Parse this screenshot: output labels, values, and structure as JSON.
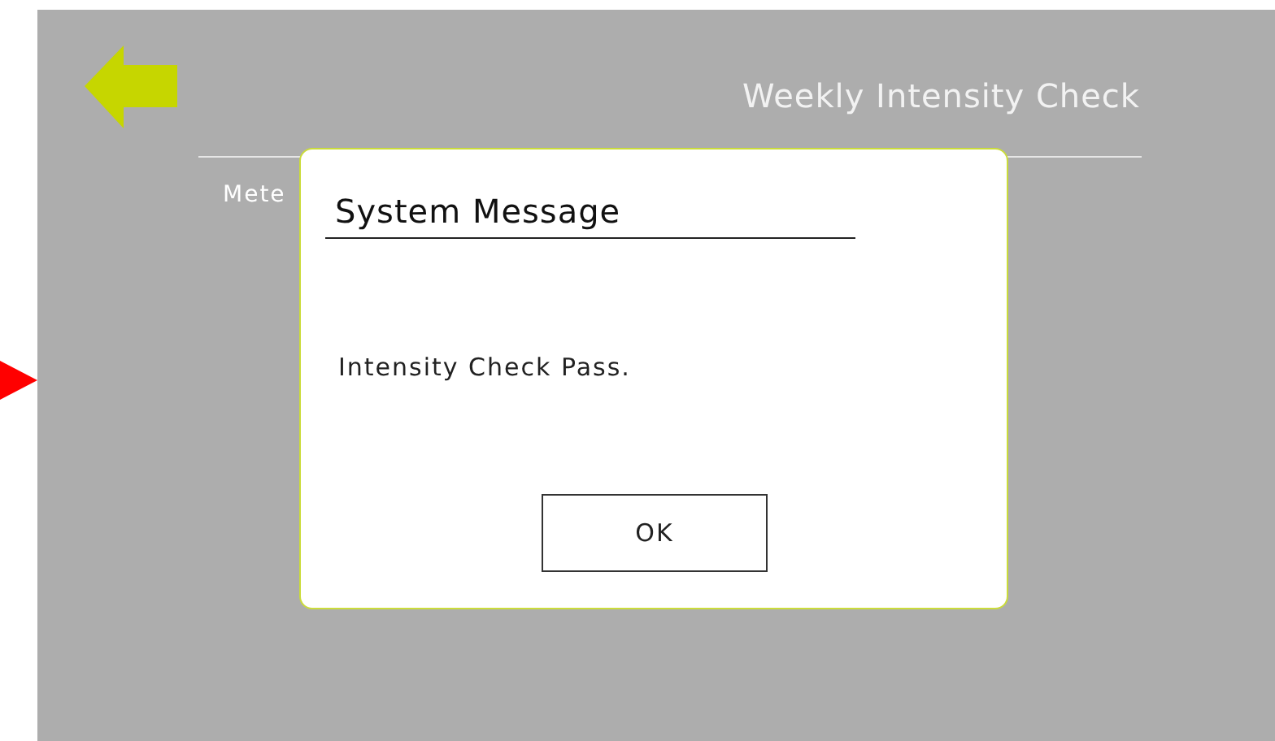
{
  "screen": {
    "title": "Weekly Intensity Check",
    "field_label": "Mete"
  },
  "dialog": {
    "title": "System Message",
    "message": "Intensity Check Pass.",
    "buttons": [
      "OK"
    ]
  }
}
